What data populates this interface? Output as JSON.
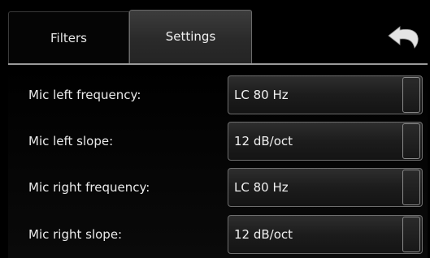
{
  "tabs": [
    {
      "label": "Filters",
      "active": false
    },
    {
      "label": "Settings",
      "active": true
    }
  ],
  "header": {
    "back_icon": "undo-arrow-icon"
  },
  "settings": [
    {
      "label": "Mic left frequency:",
      "value": "LC 80 Hz"
    },
    {
      "label": "Mic left slope:",
      "value": "12 dB/oct"
    },
    {
      "label": "Mic right frequency:",
      "value": "LC 80 Hz"
    },
    {
      "label": "Mic right slope:",
      "value": "12 dB/oct"
    }
  ],
  "colors": {
    "background": "#000000",
    "active_tab": "#2f2f2f",
    "border": "#6e6e6e",
    "text": "#ececec"
  }
}
